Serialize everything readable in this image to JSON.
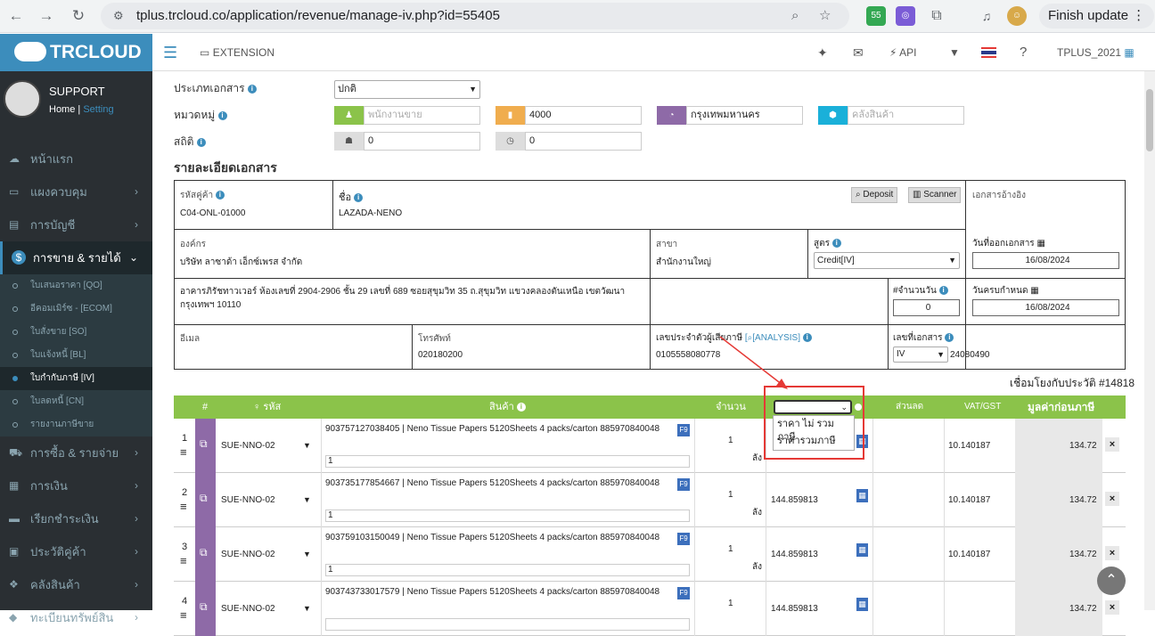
{
  "browser": {
    "url": "tplus.trcloud.co/application/revenue/manage-iv.php?id=55405",
    "finish_update": "Finish update",
    "ext_badge": "55"
  },
  "sidebar": {
    "logo": "TRCLOUD",
    "user_name": "SUPPORT",
    "home_link": "Home",
    "setting_link": "Setting",
    "items": [
      {
        "label": "หน้าแรก"
      },
      {
        "label": "แผงควบคุม"
      },
      {
        "label": "การบัญชี"
      },
      {
        "label": "การขาย & รายได้"
      },
      {
        "label": "การซื้อ & รายจ่าย"
      },
      {
        "label": "การเงิน"
      },
      {
        "label": "เรียกชำระเงิน"
      },
      {
        "label": "ประวัติคู่ค้า"
      },
      {
        "label": "คลังสินค้า"
      },
      {
        "label": "ทะเบียนทรัพย์สิน"
      }
    ],
    "subitems": [
      {
        "label": "ใบเสนอราคา [QO]"
      },
      {
        "label": "อีคอมเมิร์ซ - [ECOM]"
      },
      {
        "label": "ใบสั่งขาย [SO]"
      },
      {
        "label": "ใบแจ้งหนี้ [BL]"
      },
      {
        "label": "ใบกำกับภาษี [IV]"
      },
      {
        "label": "ใบลดหนี้ [CN]"
      },
      {
        "label": "รายงานภาษีขาย"
      }
    ]
  },
  "topnav": {
    "extension": "EXTENSION",
    "api": "API",
    "company": "TPLUS_2021"
  },
  "form": {
    "doc_type_label": "ประเภทเอกสาร",
    "doc_type_value": "ปกติ",
    "category_label": "หมวดหมู่",
    "salesperson_placeholder": "พนักงานขาย",
    "code_value": "4000",
    "region_value": "กรุงเทพมหานคร",
    "warehouse_placeholder": "คลังสินค้า",
    "stats_label": "สถิติ",
    "stat1": "0",
    "stat2": "0",
    "section_title": "รายละเอียดเอกสาร"
  },
  "details": {
    "cust_code_label": "รหัสคู่ค้า",
    "cust_code": "C04-ONL-01000",
    "name_label": "ชื่อ",
    "name": "LAZADA-NENO",
    "deposit": "Deposit",
    "scanner": "Scanner",
    "ref_label": "เอกสารอ้างอิง",
    "org_label": "องค์กร",
    "org": "บริษัท ลาซาด้า เอ็กซ์เพรส จำกัด",
    "branch_label": "สาขา",
    "branch": "สำนักงานใหญ่",
    "formula_label": "สูตร",
    "formula": "Credit[IV]",
    "doc_date_label": "วันที่ออกเอกสาร",
    "doc_date": "16/08/2024",
    "address": "อาคารภิรัชทาวเวอร์ ห้องเลขที่ 2904-2906 ชั้น 29 เลขที่ 689 ซอยสุขุมวิท 35 ถ.สุขุมวิท แขวงคลองตันเหนือ เขตวัฒนา กรุงเทพฯ 10110",
    "days_label": "#จำนวนวัน",
    "days": "0",
    "due_label": "วันครบกำหนด",
    "due_date": "16/08/2024",
    "email_label": "อีเมล",
    "phone_label": "โทรศัพท์",
    "phone": "020180200",
    "taxid_label": "เลขประจำตัวผู้เสียภาษี",
    "analysis": "[ANALYSIS]",
    "taxid": "0105558080778",
    "docno_label": "เลขที่เอกสาร",
    "docno_prefix": "IV",
    "docno": "24080490",
    "history": "เชื่อมโยงกับประวัติ #14818"
  },
  "table": {
    "headers": {
      "num": "#",
      "code": "รหัส",
      "product": "สินค้า",
      "qty": "จำนวน",
      "discount": "ส่วนลด",
      "vat": "VAT/GST",
      "amount": "มูลค่าก่อนภาษี"
    },
    "dropdown_options": [
      "ราคา ไม่ รวมภาษี",
      "ราคารวมภาษี"
    ],
    "rows": [
      {
        "n": "1",
        "code": "SUE-NNO-02",
        "product": "903757127038405 | Neno Tissue Papers 5120Sheets 4 packs/carton 885970840048",
        "note": "1",
        "qty": "1",
        "unit": "ลัง",
        "price": "",
        "vat": "10.140187",
        "amount": "134.72"
      },
      {
        "n": "2",
        "code": "SUE-NNO-02",
        "product": "903735177854667 | Neno Tissue Papers 5120Sheets 4 packs/carton 885970840048",
        "note": "1",
        "qty": "1",
        "unit": "ลัง",
        "price": "144.859813",
        "vat": "10.140187",
        "amount": "134.72"
      },
      {
        "n": "3",
        "code": "SUE-NNO-02",
        "product": "903759103150049 | Neno Tissue Papers 5120Sheets 4 packs/carton 885970840048",
        "note": "1",
        "qty": "1",
        "unit": "ลัง",
        "price": "144.859813",
        "vat": "10.140187",
        "amount": "134.72"
      },
      {
        "n": "4",
        "code": "SUE-NNO-02",
        "product": "903743733017579 | Neno Tissue Papers 5120Sheets 4 packs/carton 885970840048",
        "note": "",
        "qty": "1",
        "unit": "",
        "price": "144.859813",
        "vat": "",
        "amount": "134.72"
      }
    ]
  },
  "colors": {
    "green": "#8bc34a",
    "purple": "#8e6aa7",
    "blue": "#3c8dbc",
    "red": "#e53935"
  }
}
